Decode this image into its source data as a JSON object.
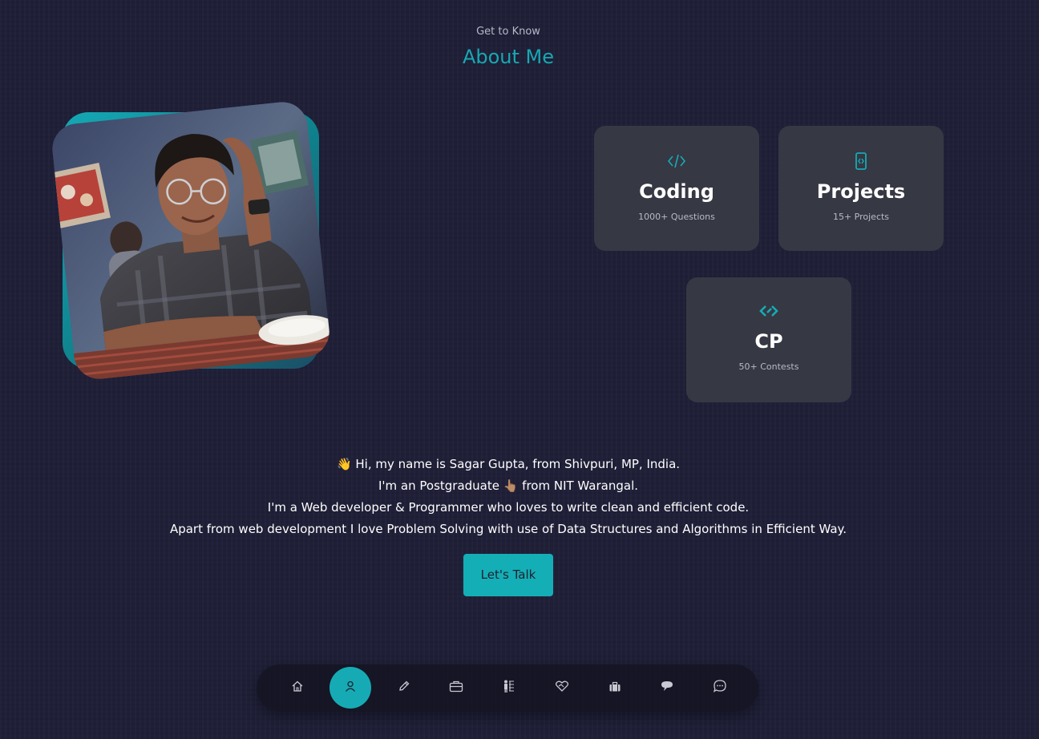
{
  "header": {
    "eyebrow": "Get to Know",
    "title": "About Me"
  },
  "profile_photo": {
    "alt": "profile photo"
  },
  "cards": [
    {
      "icon": "code-icon",
      "title": "Coding",
      "subtitle": "1000+ Questions"
    },
    {
      "icon": "mobile-code-icon",
      "title": "Projects",
      "subtitle": "15+ Projects"
    },
    {
      "icon": "competitive-programming-icon",
      "title": "CP",
      "subtitle": "50+ Contests"
    }
  ],
  "bio": {
    "line1": "👋 Hi, my name is Sagar Gupta, from Shivpuri, MP, India.",
    "line2": "I'm an Postgraduate 👆🏽 from NIT Warangal.",
    "line3": "I'm a Web developer & Programmer who loves to write clean and efficient code.",
    "line4": "Apart from web development I love Problem Solving with use of Data Structures and Algorithms in Efficient Way."
  },
  "cta": {
    "label": "Let's Talk"
  },
  "nav": {
    "items": [
      {
        "name": "home",
        "icon": "home-icon",
        "active": false
      },
      {
        "name": "about",
        "icon": "user-icon",
        "active": true
      },
      {
        "name": "skills",
        "icon": "pencil-icon",
        "active": false
      },
      {
        "name": "experience",
        "icon": "briefcase-icon",
        "active": false
      },
      {
        "name": "education",
        "icon": "graduation-icon",
        "active": false
      },
      {
        "name": "services",
        "icon": "handshake-heart-icon",
        "active": false
      },
      {
        "name": "portfolio",
        "icon": "case-icon",
        "active": false
      },
      {
        "name": "testimonials",
        "icon": "speech-bubble-icon",
        "active": false
      },
      {
        "name": "contact",
        "icon": "chat-icon",
        "active": false
      }
    ]
  },
  "colors": {
    "background": "#1f1f38",
    "accent": "#16abb4",
    "card": "#363843",
    "text": "#ffffff",
    "muted": "#b9bac4"
  }
}
